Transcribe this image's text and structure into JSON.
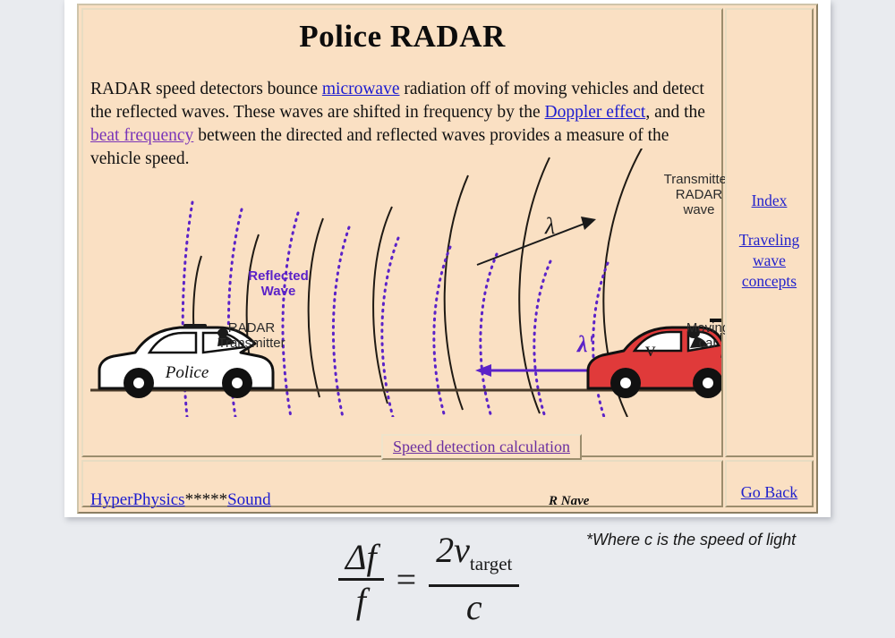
{
  "page": {
    "background_color": "#e9ebef",
    "slide_background": "#ffffff",
    "panel_color": "#fae0c3",
    "link_color": "#2222cc",
    "violet_link_color": "#7a35b8"
  },
  "header": {
    "title": "Police RADAR"
  },
  "intro": {
    "part1": "RADAR speed detectors bounce ",
    "link_microwave": "microwave",
    "part2": " radiation off of moving vehicles and detect the reflected waves. These waves are shifted in frequency by the ",
    "link_doppler": "Doppler effect",
    "part3": ", and the ",
    "link_beat": "beat frequency",
    "part4": " between the directed and reflected waves provides a measure of the vehicle speed."
  },
  "sidebar": {
    "items": [
      {
        "label": "Index"
      },
      {
        "label": "Traveling wave concepts"
      }
    ]
  },
  "diagram": {
    "labels": {
      "transmitted_wave": "Transmitted\nRADAR\nwave",
      "reflected_wave": "Reflected\nWave",
      "radar_transmitter": "RADAR\nTransmitter",
      "moving_car": "Moving\ncar",
      "police_text": "Police",
      "lambda": "λ",
      "lambda_prime": "λ'",
      "velocity": "v"
    },
    "colors": {
      "transmitted_wave_line": "#1f1a14",
      "reflected_wave_line": "#5b22c8",
      "police_car_body": "#ffffff",
      "moving_car_body": "#e03a3a",
      "ground_line": "#4a3b2a"
    },
    "calculation_link": "Speed detection calculation"
  },
  "footer": {
    "hyperphysics": "HyperPhysics",
    "stars": "*****",
    "sound": "Sound",
    "author": "R Nave",
    "go_back": "Go Back"
  },
  "formula": {
    "numerator_left": "Δf",
    "denominator_left": "f",
    "equals": "=",
    "numerator_right": "2v",
    "numerator_right_sub": "target",
    "denominator_right": "c",
    "note": "*Where c is the speed of light"
  }
}
